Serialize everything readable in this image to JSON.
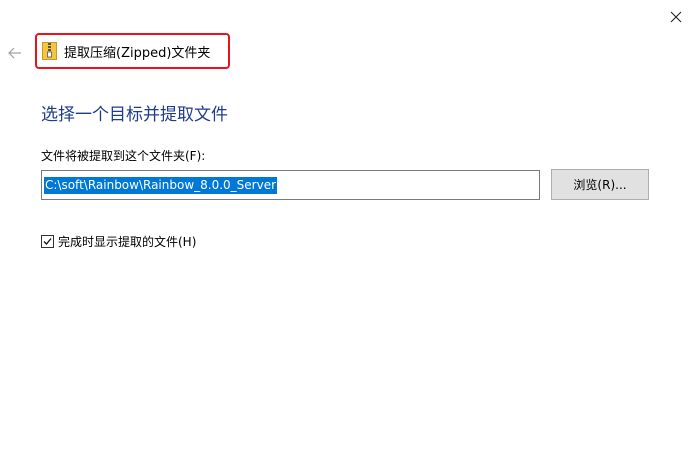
{
  "window": {
    "title": "提取压缩(Zipped)文件夹"
  },
  "icons": {
    "close": "close-icon",
    "back": "back-arrow-icon",
    "zip_folder": "zipped-folder-icon",
    "check": "checkmark-icon"
  },
  "main": {
    "heading": "选择一个目标并提取文件",
    "field_label": "文件将被提取到这个文件夹(F):",
    "path_value": "C:\\soft\\Rainbow\\Rainbow_8.0.0_Server",
    "browse_label": "浏览(R)...",
    "checkbox_label": "完成时显示提取的文件(H)",
    "checkbox_checked": true
  },
  "colors": {
    "heading": "#1e3c8c",
    "selection": "#0078d7",
    "highlight_border": "#e8141c",
    "button_bg": "#e1e1e1"
  }
}
